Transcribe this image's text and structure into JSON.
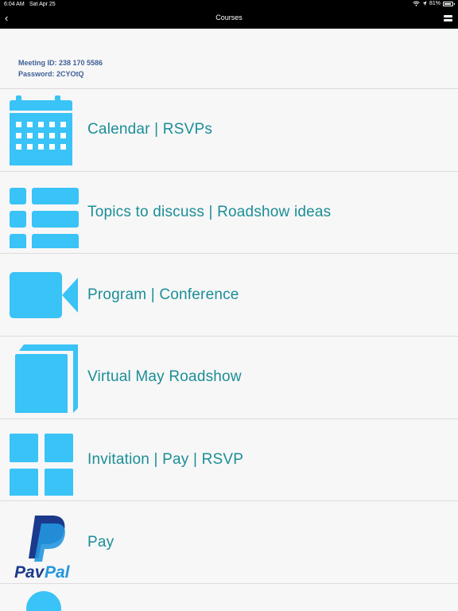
{
  "status_bar": {
    "time": "6:04 AM",
    "date": "Sat Apr 25",
    "battery": "81%"
  },
  "nav": {
    "back_label": "‹",
    "title": "Courses"
  },
  "meeting": {
    "id_line": "Meeting ID: 238 170 5586",
    "password_line": "Password: 2CYOtQ"
  },
  "items": [
    {
      "label": "Calendar | RSVPs",
      "icon": "calendar-icon"
    },
    {
      "label": "Topics to discuss | Roadshow ideas",
      "icon": "list-icon"
    },
    {
      "label": "Program | Conference",
      "icon": "video-camera-icon"
    },
    {
      "label": "Virtual May Roadshow",
      "icon": "book-icon"
    },
    {
      "label": "Invitation | Pay | RSVP",
      "icon": "grid-icon"
    },
    {
      "label": "Pay",
      "icon": "paypal-logo"
    }
  ],
  "colors": {
    "icon_blue": "#39c3f6",
    "label_teal": "#1b8e97",
    "meeting_text": "#3f5f96",
    "paypal_dark": "#1b3a8c",
    "paypal_light": "#2596de"
  }
}
